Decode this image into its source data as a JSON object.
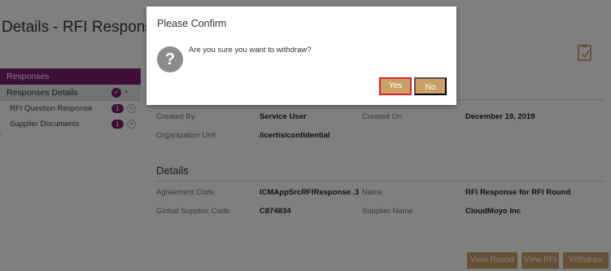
{
  "page": {
    "title": "Details - RFI Response - RFI Round"
  },
  "sidebar": {
    "header": "Responses",
    "section": "Responses Details",
    "items": [
      {
        "label": "RFI Question Response",
        "badge": "1"
      },
      {
        "label": "Supplier Documents",
        "badge": "1"
      }
    ]
  },
  "main": {
    "top_fields": [
      {
        "label": "Created By",
        "value": "Service User"
      },
      {
        "label": "Created On",
        "value": "December 19, 2019"
      },
      {
        "label": "Organization Unit",
        "value": "/icertis/confidential"
      }
    ],
    "details_title": "Details",
    "detail_fields": [
      {
        "label": "Agreement Code",
        "value": "ICMAppSrcRFIResponse_3"
      },
      {
        "label": "Name",
        "value": "RFI Response for RFI Round"
      },
      {
        "label": "Global Supplier Code",
        "value": "C874834"
      },
      {
        "label": "Supplier Name",
        "value": "CloudMoyo Inc"
      }
    ]
  },
  "actions": {
    "view_round": "View Round",
    "view_rfi": "View RFI",
    "withdraw": "Withdraw"
  },
  "dialog": {
    "title": "Please Confirm",
    "icon": "question-icon",
    "message": "Are you sure you want to withdraw?",
    "yes_label": "Yes",
    "no_label": "No"
  },
  "colors": {
    "brand_purple": "#7d1f6f",
    "button_gold": "#c9a066",
    "focus_red": "#d9232d",
    "overlay": "rgba(0,0,0,0.5)"
  }
}
